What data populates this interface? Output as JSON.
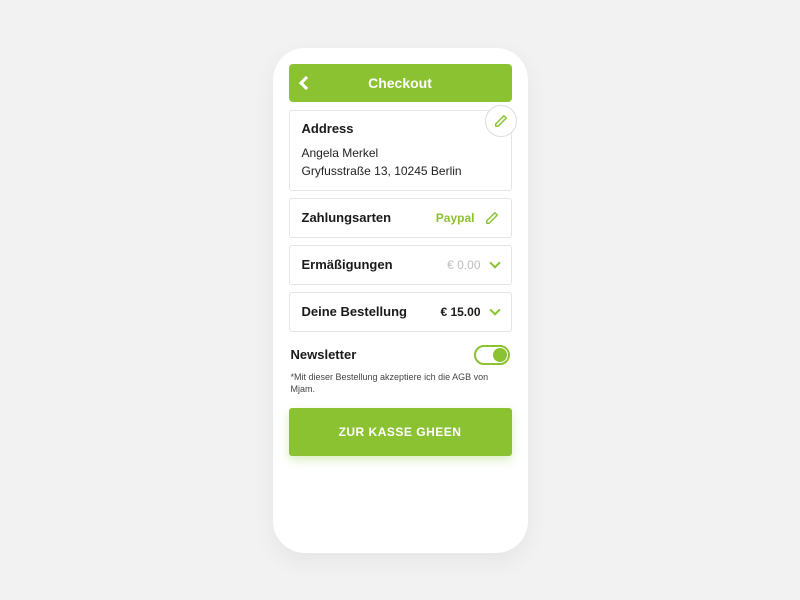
{
  "header": {
    "title": "Checkout"
  },
  "address": {
    "heading": "Address",
    "name": "Angela Merkel",
    "line": "Gryfusstraße 13, 10245 Berlin"
  },
  "rows": {
    "payment": {
      "label": "Zahlungsarten",
      "value": "Paypal"
    },
    "discounts": {
      "label": "Ermäßigungen",
      "value": "€ 0.00"
    },
    "order": {
      "label": "Deine Bestellung",
      "value": "€ 15.00"
    }
  },
  "newsletter": {
    "label": "Newsletter",
    "enabled": true
  },
  "disclaimer": "*Mit dieser Bestellung akzeptiere ich die AGB von Mjam.",
  "cta": "ZUR KASSE GHEEN",
  "colors": {
    "accent": "#8bc232"
  }
}
